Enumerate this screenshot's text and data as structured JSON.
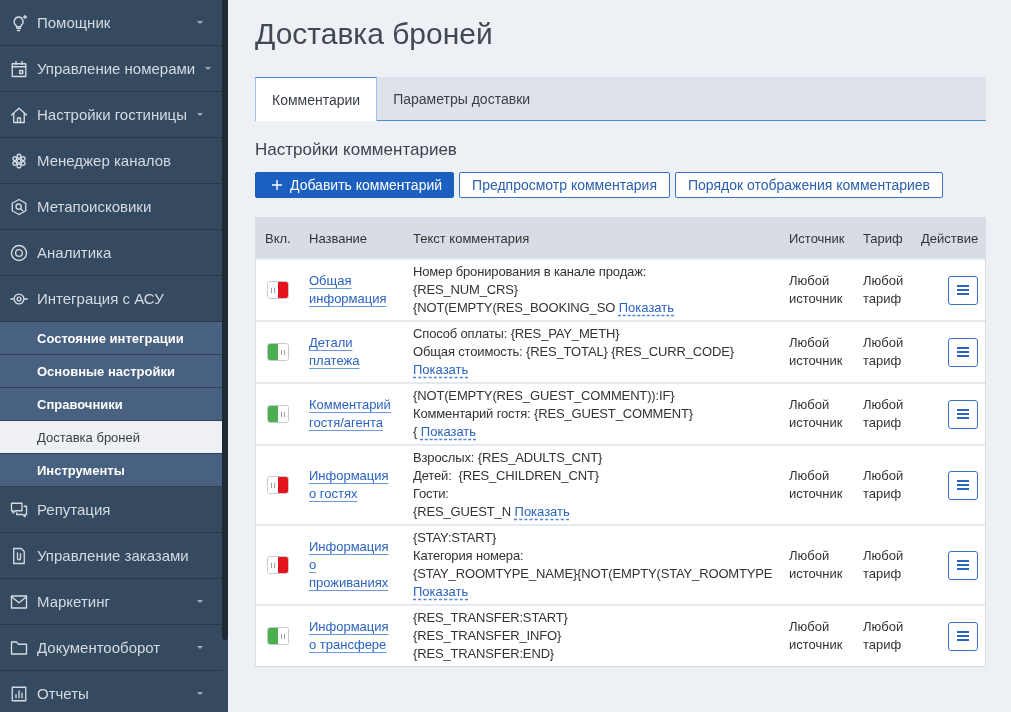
{
  "sidebar": {
    "items": [
      {
        "label": "Помощник",
        "dropdown": true
      },
      {
        "label": "Управление номерами",
        "dropdown": true
      },
      {
        "label": "Настройки гостиницы",
        "dropdown": true
      },
      {
        "label": "Менеджер каналов",
        "dropdown": false
      },
      {
        "label": "Метапоисковики",
        "dropdown": false
      },
      {
        "label": "Аналитика",
        "dropdown": false
      },
      {
        "label": "Интеграция с АСУ",
        "dropdown": false,
        "children": [
          {
            "label": "Состояние интеграции",
            "selected": false
          },
          {
            "label": "Основные настройки",
            "selected": false
          },
          {
            "label": "Справочники",
            "selected": false
          },
          {
            "label": "Доставка броней",
            "selected": true
          },
          {
            "label": "Инструменты",
            "selected": false
          }
        ]
      },
      {
        "label": "Репутация",
        "dropdown": false
      },
      {
        "label": "Управление заказами",
        "dropdown": false
      },
      {
        "label": "Маркетинг",
        "dropdown": true
      },
      {
        "label": "Документооборот",
        "dropdown": true
      },
      {
        "label": "Отчеты",
        "dropdown": true
      }
    ]
  },
  "page": {
    "title": "Доставка броней"
  },
  "tabs": [
    {
      "label": "Комментарии",
      "selected": true
    },
    {
      "label": "Параметры доставки",
      "selected": false
    }
  ],
  "section": {
    "title": "Настройки комментариев",
    "buttons": [
      {
        "label": "Добавить комментарий",
        "kind": "primary"
      },
      {
        "label": "Предпросмотр комментария",
        "kind": "outline"
      },
      {
        "label": "Порядок отображения комментариев",
        "kind": "outline"
      }
    ]
  },
  "table": {
    "columns": [
      "Вкл.",
      "Название",
      "Текст комментария",
      "Источник",
      "Тариф",
      "Действие"
    ],
    "rows": [
      {
        "enabled": false,
        "name": "Общая информация",
        "comment": {
          "text": "Номер бронирования в канале продаж:\n{RES_NUM_CRS}\n{NOT(EMPTY(RES_BOOKING_SO",
          "more_link": "Показать"
        },
        "source": "Любой источник",
        "tariff": "Любой тариф"
      },
      {
        "enabled": true,
        "name": "Детали платежа",
        "comment": {
          "text": "Способ оплаты: {RES_PAY_METH}\nОбщая стоимость: {RES_TOTAL} {RES_CURR_CODE}\n",
          "more_link": "Показать"
        },
        "source": "Любой источник",
        "tariff": "Любой тариф"
      },
      {
        "enabled": true,
        "name": "Комментарий гостя/агента",
        "comment": {
          "text": "{NOT(EMPTY(RES_GUEST_COMMENT)):IF}\nКомментарий гостя: {RES_GUEST_COMMENT}\n{",
          "more_link": "Показать"
        },
        "source": "Любой источник",
        "tariff": "Любой тариф"
      },
      {
        "enabled": false,
        "name": "Информация о гостях",
        "comment": {
          "text": "Взрослых: {RES_ADULTS_CNT}\nДетей:  {RES_CHILDREN_CNT}\nГости:\n{RES_GUEST_N",
          "more_link": "Показать"
        },
        "source": "Любой источник",
        "tariff": "Любой тариф"
      },
      {
        "enabled": false,
        "name": "Информация о проживаниях",
        "comment": {
          "text": "{STAY:START}\nКатегория номера:\n{STAY_ROOMTYPE_NAME}{NOT(EMPTY(STAY_ROOMTYPE\n",
          "more_link": "Показать"
        },
        "source": "Любой источник",
        "tariff": "Любой тариф"
      },
      {
        "enabled": true,
        "name": "Информация о трансфере",
        "comment": {
          "text": "{RES_TRANSFER:START}\n{RES_TRANSFER_INFO}\n{RES_TRANSFER:END}"
        },
        "source": "Любой источник",
        "tariff": "Любой тариф"
      }
    ]
  }
}
